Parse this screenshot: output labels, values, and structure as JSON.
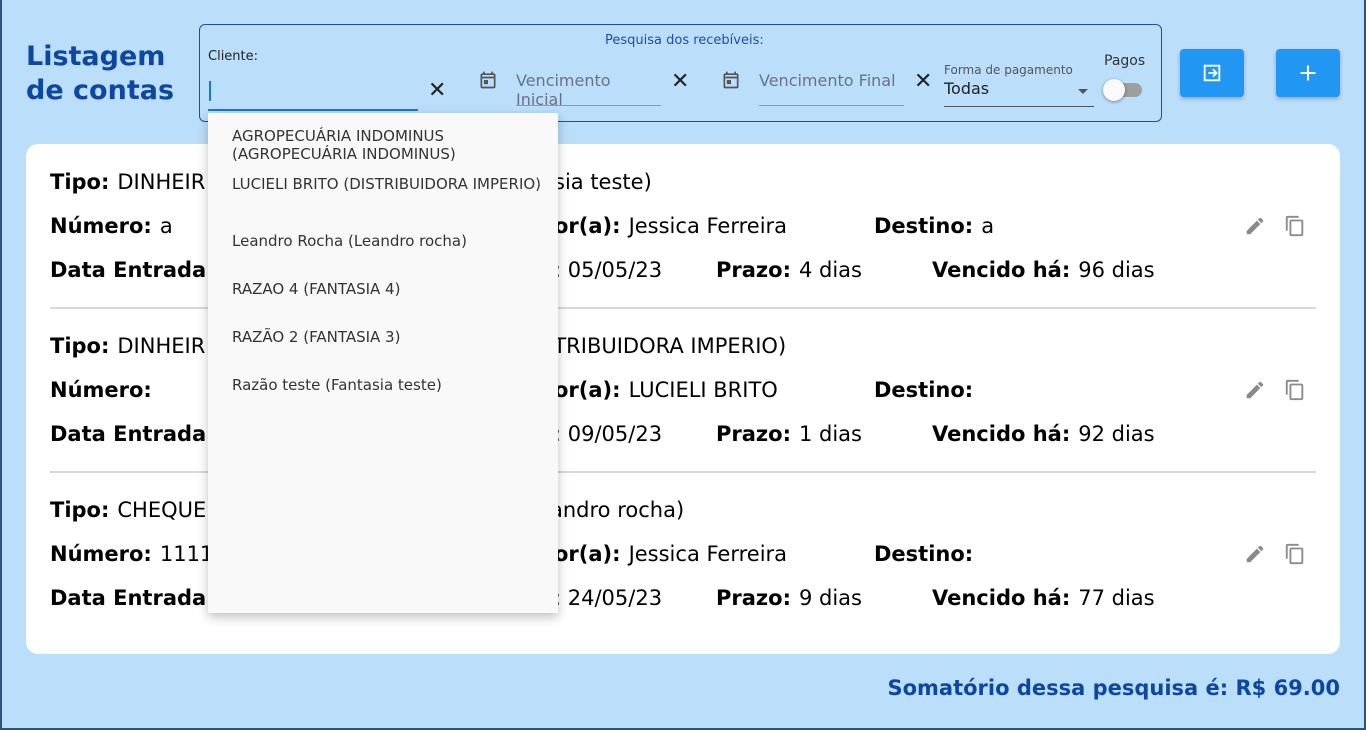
{
  "page_title_line1": "Listagem",
  "page_title_line2": "de contas",
  "search": {
    "legend": "Pesquisa dos recebíveis:",
    "cliente_label": "Cliente:",
    "cliente_value": "",
    "venc_inicial_placeholder": "Vencimento Inicial",
    "venc_final_placeholder": "Vencimento Final",
    "forma_pagamento_label": "Forma de pagamento",
    "forma_pagamento_value": "Todas",
    "pagos_label": "Pagos",
    "pagos_checked": false
  },
  "dropdown_options": [
    "AGROPECUÁRIA INDOMINUS (AGROPECUÁRIA INDOMINUS)",
    "LUCIELI BRITO (DISTRIBUIDORA IMPERIO)",
    "Leandro Rocha (Leandro rocha)",
    "RAZAO 4 (FANTASIA 4)",
    "RAZÃO 2 (FANTASIA 3)",
    "Razão teste (Fantasia teste)"
  ],
  "labels": {
    "tipo": "Tipo:",
    "numero": "Número:",
    "vendedor_suffix": "or(a):",
    "destino": "Destino:",
    "data_entrada": "Data Entrada:",
    "prazo": "Prazo:",
    "vencido": "Vencido há:"
  },
  "records": [
    {
      "tipo_left": "DINHEIR",
      "tipo_right": "sia teste)",
      "numero": "a",
      "vendedor": "Jessica Ferreira",
      "destino": "a",
      "vencimento_partial": ": 05/05/23",
      "prazo": "4 dias",
      "vencido": "96 dias"
    },
    {
      "tipo_left": "DINHEIR",
      "tipo_right": "STRIBUIDORA IMPERIO)",
      "numero": "",
      "vendedor": "LUCIELI BRITO",
      "destino": "",
      "vencimento_partial": ": 09/05/23",
      "prazo": "1 dias",
      "vencido": "92 dias"
    },
    {
      "tipo_left": "CHEQUE",
      "tipo_right": "andro rocha)",
      "numero": "1111",
      "vendedor": "Jessica Ferreira",
      "destino": "",
      "vencimento_partial": ": 24/05/23",
      "prazo": "9 dias",
      "vencido": "77 dias"
    }
  ],
  "footer_sum": "Somatório dessa pesquisa é: R$ 69.00",
  "colors": {
    "background": "#bbdefb",
    "primary": "#2196f3",
    "title": "#0d47a1"
  }
}
